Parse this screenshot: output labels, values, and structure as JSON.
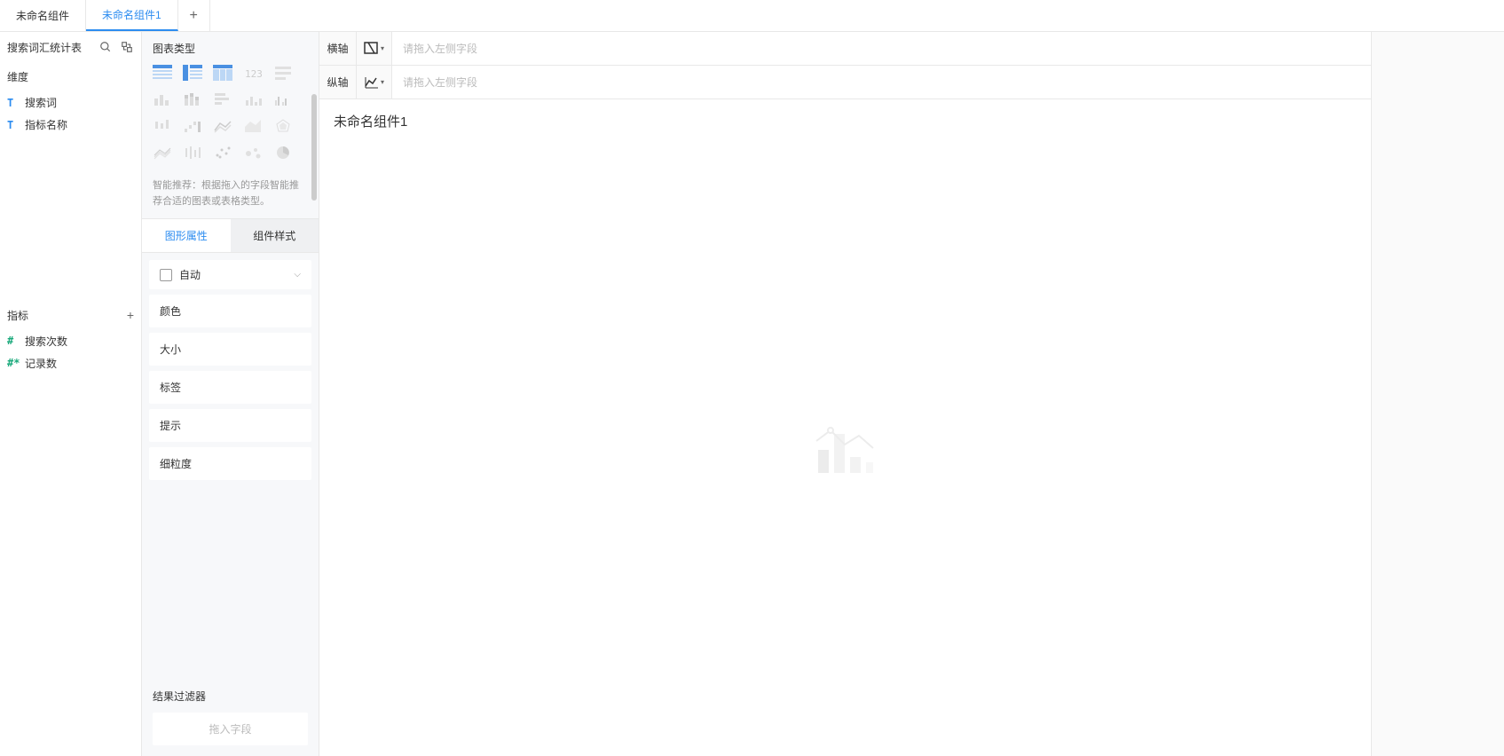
{
  "tabs": {
    "items": [
      {
        "label": "未命名组件",
        "active": false
      },
      {
        "label": "未命名组件1",
        "active": true
      }
    ]
  },
  "left": {
    "datasource_title": "搜索词汇统计表",
    "dimension_header": "维度",
    "dimension_fields": [
      {
        "label": "搜索词",
        "type": "text"
      },
      {
        "label": "指标名称",
        "type": "text"
      }
    ],
    "measure_header": "指标",
    "measure_fields": [
      {
        "label": "搜索次数",
        "type": "number",
        "prefix": "#"
      },
      {
        "label": "记录数",
        "type": "number",
        "prefix": "#*"
      }
    ]
  },
  "mid": {
    "chart_type_header": "图表类型",
    "recommend_text": "智能推荐：根据拖入的字段智能推荐合适的图表或表格类型。",
    "sub_tabs": {
      "graphic_props": "图形属性",
      "component_style": "组件样式"
    },
    "auto_label": "自动",
    "props": {
      "color": "颜色",
      "size": "大小",
      "label": "标签",
      "tooltip": "提示",
      "granularity": "细粒度"
    },
    "filter_title": "结果过滤器",
    "filter_placeholder": "拖入字段"
  },
  "right": {
    "x_axis_label": "横轴",
    "y_axis_label": "纵轴",
    "axis_placeholder": "请拖入左侧字段",
    "canvas_title": "未命名组件1"
  }
}
